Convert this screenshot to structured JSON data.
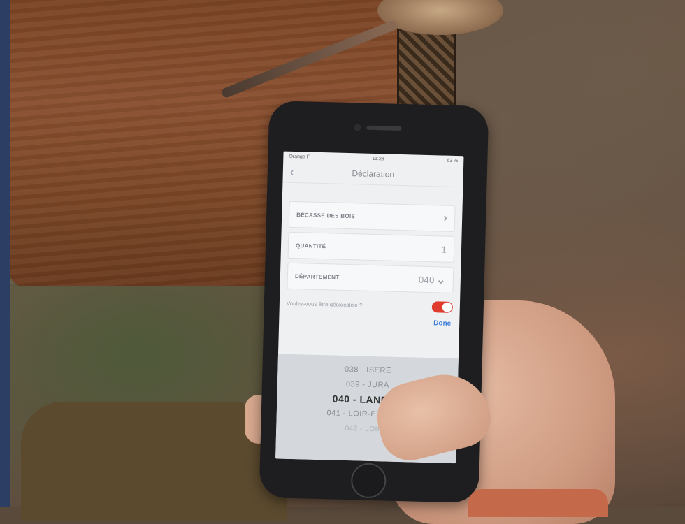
{
  "phone_screen": {
    "status": {
      "carrier": "Orange F",
      "time": "11:28",
      "battery": "63 %"
    },
    "nav_title": "Déclaration",
    "subtitle": "",
    "fields": [
      {
        "label": "BÉCASSE DES BOIS",
        "value": "",
        "control": "chevron"
      },
      {
        "label": "QUANTITÉ",
        "value": "1",
        "control": "none"
      },
      {
        "label": "DÉPARTEMENT",
        "value": "040",
        "control": "dropdown"
      }
    ],
    "geo_question": "Voulez-vous être géolocalisé ?",
    "geo_toggle_on": true,
    "done_label": "Done",
    "picker_items": [
      {
        "text": "038 - ISERE",
        "state": "normal"
      },
      {
        "text": "039 - JURA",
        "state": "normal"
      },
      {
        "text": "040 - LANDES",
        "state": "selected"
      },
      {
        "text": "041 - LOIR-ET-CHER",
        "state": "normal"
      },
      {
        "text": "042 - LOIRE",
        "state": "faded"
      }
    ]
  },
  "colors": {
    "toggle_on": "#e03b2f",
    "done_blue": "#3b7bd8",
    "stock_wood": "#8a5030"
  }
}
